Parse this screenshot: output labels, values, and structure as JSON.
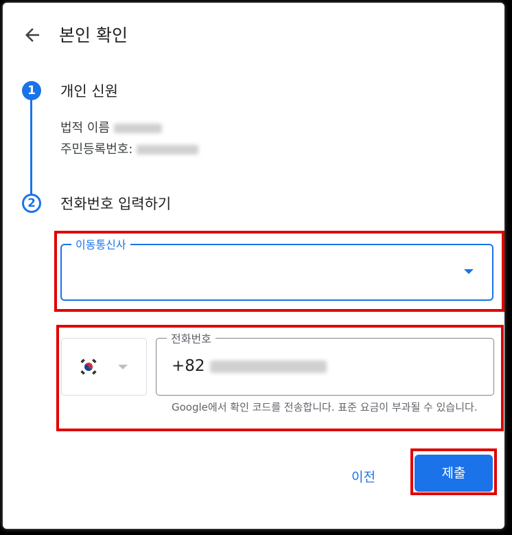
{
  "header": {
    "title": "본인 확인"
  },
  "steps": [
    {
      "number": "1",
      "title": "개인 신원"
    },
    {
      "number": "2",
      "title": "전화번호 입력하기"
    }
  ],
  "identity": {
    "name_label": "법적 이름",
    "id_label": "주민등록번호:"
  },
  "carrier": {
    "label": "이동통신사",
    "value": ""
  },
  "phone": {
    "label": "전화번호",
    "value_prefix": "+82",
    "country_flag": "korea-flag",
    "helper": "Google에서 확인 코드를 전송합니다. 표준 요금이 부과될 수 있습니다."
  },
  "actions": {
    "prev": "이전",
    "submit": "제출"
  },
  "colors": {
    "accent": "#1a73e8",
    "highlight": "#e00000"
  }
}
